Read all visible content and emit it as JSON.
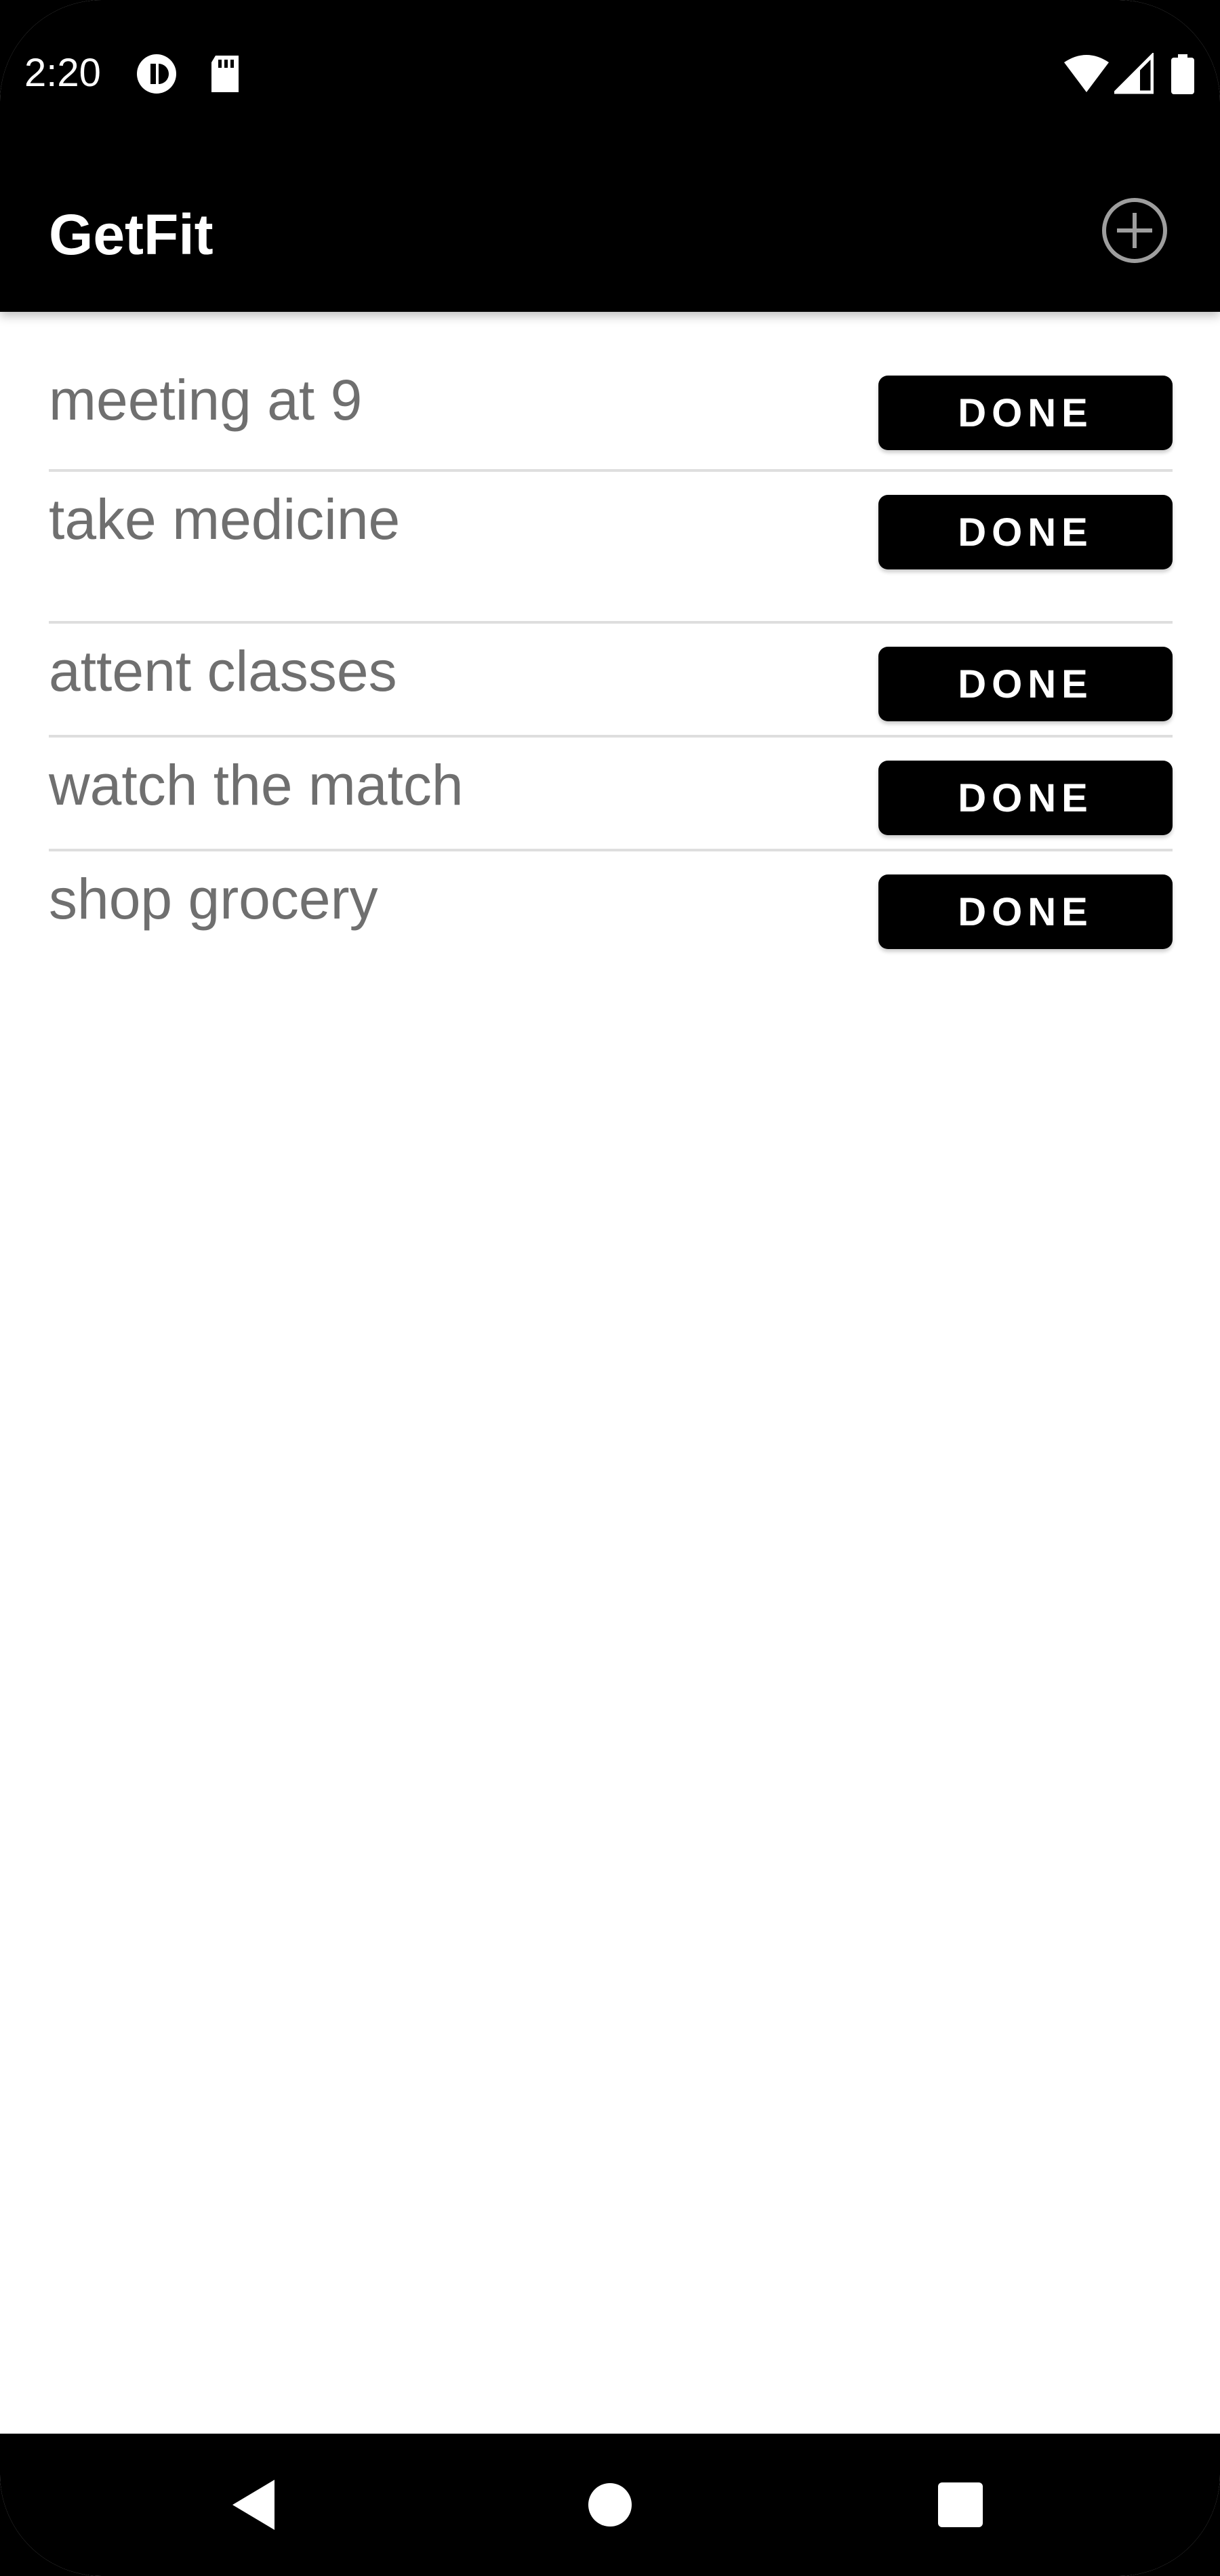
{
  "status_bar": {
    "time": "2:20",
    "left_icons": [
      "data-saver-icon",
      "sd-card-icon"
    ],
    "right_icons": [
      "wifi-icon",
      "cell-signal-icon",
      "battery-icon"
    ]
  },
  "app_bar": {
    "title": "GetFit",
    "add_icon": "add-circle-icon"
  },
  "tasks": [
    {
      "label": "meeting at 9",
      "button": "DONE"
    },
    {
      "label": "take medicine",
      "button": "DONE"
    },
    {
      "label": "attent classes",
      "button": "DONE"
    },
    {
      "label": "watch the match",
      "button": "DONE"
    },
    {
      "label": "shop grocery",
      "button": "DONE"
    }
  ],
  "nav_bar": {
    "buttons": [
      "back-icon",
      "home-icon",
      "recents-icon"
    ]
  },
  "colors": {
    "bar_background": "#000000",
    "content_background": "#ffffff",
    "task_text": "#6f6f6f",
    "divider": "#dedede",
    "button_background": "#000000",
    "button_text": "#ffffff"
  }
}
